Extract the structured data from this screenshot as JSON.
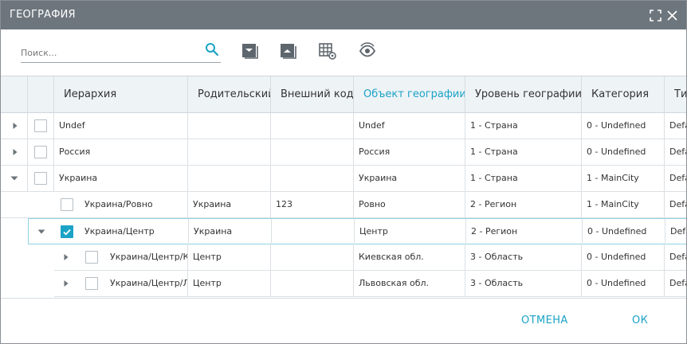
{
  "dialog": {
    "title": "ГЕОГРАФИЯ"
  },
  "icons": {
    "maximize": "maximize-icon",
    "close": "close-icon",
    "search": "search-icon",
    "collapse_all": "collapse-all-icon",
    "expand_all": "expand-all-icon",
    "grid_settings": "grid-settings-icon",
    "view_toggle": "eye-refresh-icon"
  },
  "colors": {
    "titlebar": "#6e767d",
    "accent": "#1ba3c6",
    "header_bg": "#eef3f6"
  },
  "search": {
    "placeholder": "Поиск...",
    "value": ""
  },
  "grid": {
    "columns": [
      "Иерархия",
      "Родительский",
      "Внешний код",
      "Объект географии",
      "Уровень географии",
      "Категория",
      "Ти"
    ],
    "active_column": "Объект географии",
    "rows": [
      {
        "hierarchy": "Undef",
        "parent": "",
        "ext_code": "",
        "object": "Undef",
        "level": "1 - Страна",
        "category": "0 - Undefined",
        "type": "Defa",
        "checked": false
      },
      {
        "hierarchy": "Россия",
        "parent": "",
        "ext_code": "",
        "object": "Россия",
        "level": "1 - Страна",
        "category": "0 - Undefined",
        "type": "Defa",
        "checked": false
      },
      {
        "hierarchy": "Украина",
        "parent": "",
        "ext_code": "",
        "object": "Украина",
        "level": "1 - Страна",
        "category": "1 - MainCity",
        "type": "Defa",
        "checked": false
      },
      {
        "hierarchy": "Украина/Ровно",
        "parent": "Украина",
        "ext_code": "123",
        "object": "Ровно",
        "level": "2 - Регион",
        "category": "1 - MainCity",
        "type": "Defa",
        "checked": false
      },
      {
        "hierarchy": "Украина/Центр",
        "parent": "Украина",
        "ext_code": "",
        "object": "Центр",
        "level": "2 - Регион",
        "category": "0 - Undefined",
        "type": "Defa",
        "checked": true
      },
      {
        "hierarchy": "Украина/Центр/К",
        "parent": "Центр",
        "ext_code": "",
        "object": "Киевская обл.",
        "level": "3 - Область",
        "category": "0 - Undefined",
        "type": "Defa",
        "checked": false
      },
      {
        "hierarchy": "Украина/Центр/Л",
        "parent": "Центр",
        "ext_code": "",
        "object": "Львовская обл.",
        "level": "3 - Область",
        "category": "0 - Undefined",
        "type": "Defa",
        "checked": false
      }
    ]
  },
  "footer": {
    "cancel_label": "ОТМЕНА",
    "ok_label": "ОК"
  }
}
